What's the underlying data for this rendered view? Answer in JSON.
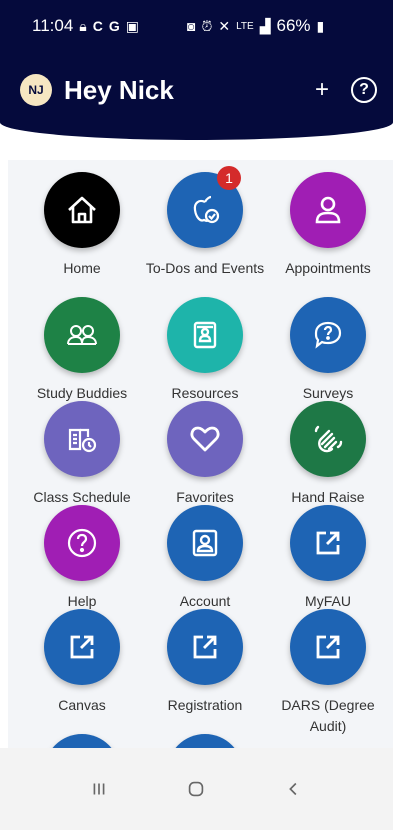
{
  "status_bar": {
    "time": "11:04",
    "left_icons": [
      "lock-icon",
      "c-icon",
      "g-icon",
      "image-icon"
    ],
    "right_icons": [
      "nfc-icon",
      "alarm-icon",
      "mute-icon",
      "lte-icon",
      "signal-icon"
    ],
    "battery": "66%"
  },
  "header": {
    "avatar_initials": "NJ",
    "greeting": "Hey Nick",
    "add_label": "+",
    "help_label": "?"
  },
  "tiles": [
    {
      "label": "Home",
      "icon": "home-icon",
      "color": "#000000"
    },
    {
      "label": "To-Dos and Events",
      "icon": "apple-check-icon",
      "color": "#1e64b4",
      "badge": "1"
    },
    {
      "label": "Appointments",
      "icon": "person-icon",
      "color": "#a01eb4"
    },
    {
      "label": "Study Buddies",
      "icon": "buddies-icon",
      "color": "#1e8246"
    },
    {
      "label": "Resources",
      "icon": "resources-icon",
      "color": "#1eb4aa"
    },
    {
      "label": "Surveys",
      "icon": "survey-icon",
      "color": "#1e64b4"
    },
    {
      "label": "Class Schedule",
      "icon": "schedule-icon",
      "color": "#6e64be"
    },
    {
      "label": "Favorites",
      "icon": "heart-icon",
      "color": "#6e64be"
    },
    {
      "label": "Hand Raise",
      "icon": "hand-raise-icon",
      "color": "#1e7846"
    },
    {
      "label": "Help",
      "icon": "help-icon",
      "color": "#a01eb4"
    },
    {
      "label": "Account",
      "icon": "account-icon",
      "color": "#1e64b4"
    },
    {
      "label": "MyFAU",
      "icon": "external-link-icon",
      "color": "#1e64b4"
    },
    {
      "label": "Canvas",
      "icon": "external-link-icon",
      "color": "#1e64b4"
    },
    {
      "label": "Registration",
      "icon": "external-link-icon",
      "color": "#1e64b4"
    },
    {
      "label": "DARS (Degree Audit)",
      "icon": "external-link-icon",
      "color": "#1e64b4"
    },
    {
      "label": "",
      "icon": "external-link-icon",
      "color": "#1e64b4"
    },
    {
      "label": "",
      "icon": "external-link-icon",
      "color": "#1e64b4"
    }
  ],
  "nav": {
    "recents_icon": "recent-apps-icon",
    "home_icon": "home-button-icon",
    "back_icon": "back-icon"
  }
}
